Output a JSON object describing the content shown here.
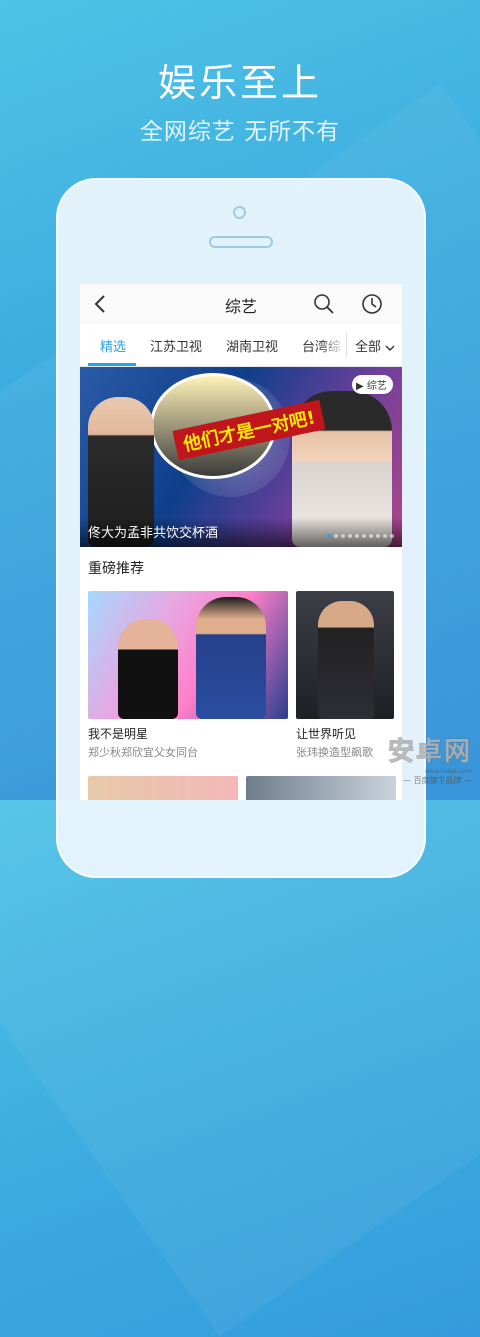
{
  "promo": {
    "title": "娱乐至上",
    "subtitle": "全网综艺 无所不有"
  },
  "navbar": {
    "title": "综艺",
    "back_icon": "back-arrow-icon",
    "search_icon": "search-icon",
    "history_icon": "clock-icon"
  },
  "tabs": {
    "items": [
      "精选",
      "江苏卫视",
      "湖南卫视",
      "台湾综"
    ],
    "active_index": 0,
    "all_label": "全部"
  },
  "banner": {
    "caption": "佟大为孟非共饮交杯酒",
    "logo_label": "综艺",
    "slogan": "他们才是一对吧!",
    "slide_count": 10,
    "active_slide": 0
  },
  "section": {
    "title": "重磅推荐"
  },
  "cards": [
    {
      "title": "我不是明星",
      "subtitle": "郑少秋郑欣宜父女同台"
    },
    {
      "title": "让世界听见",
      "subtitle": "张玮换造型飙歌"
    }
  ],
  "watermark": {
    "main": "安卓网",
    "url": "www.hiapk.com",
    "sub": "— 百度旗下品牌 —"
  },
  "colors": {
    "accent": "#2aa2e8",
    "background": "#3aa9df"
  }
}
